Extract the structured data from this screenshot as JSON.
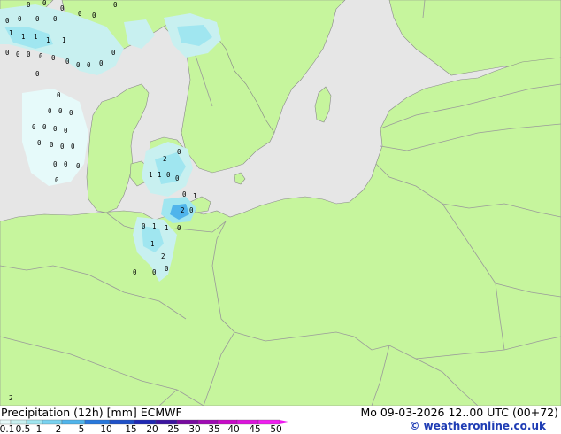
{
  "legend": {
    "title": "Precipitation (12h) [mm] ECMWF",
    "datetime": "Mo 09-03-2026 12..00 UTC (00+72)",
    "credit": "© weatheronline.co.uk",
    "classes": [
      {
        "label": "0.1",
        "color": "#e6fafa"
      },
      {
        "label": "0.5",
        "color": "#c8f0f0"
      },
      {
        "label": "1",
        "color": "#a0e6f0"
      },
      {
        "label": "2",
        "color": "#78d2f0"
      },
      {
        "label": "5",
        "color": "#50b4eb"
      },
      {
        "label": "10",
        "color": "#2878dc"
      },
      {
        "label": "15",
        "color": "#1e50c8"
      },
      {
        "label": "20",
        "color": "#1e28b4"
      },
      {
        "label": "25",
        "color": "#3c14a0"
      },
      {
        "label": "30",
        "color": "#780aa0"
      },
      {
        "label": "35",
        "color": "#a00ab4"
      },
      {
        "label": "40",
        "color": "#c80ac8"
      },
      {
        "label": "45",
        "color": "#dc14dc"
      },
      {
        "label": "50",
        "color": "#f01ef0"
      }
    ]
  },
  "map": {
    "colors": {
      "land": "#c6f59d",
      "sea": "#e6e6e6",
      "borders": "#9a9a9a",
      "coast": "#8a8a8a"
    },
    "labels": {
      "skagerrak": [
        "0",
        "0",
        "0",
        "0",
        "0",
        "0",
        "0",
        "0",
        "0",
        "0",
        "1",
        "1",
        "1",
        "1",
        "1",
        "0",
        "0",
        "0",
        "0",
        "0",
        "0",
        "0",
        "0",
        "0",
        "0"
      ],
      "northsea": [
        "0",
        "0",
        "0",
        "0",
        "0",
        "0",
        "0",
        "0",
        "0",
        "0",
        "0",
        "0",
        "0",
        "0",
        "0",
        "0",
        "0"
      ],
      "islands": [
        "2",
        "0",
        "1",
        "1",
        "0",
        "0",
        "0",
        "1",
        "2",
        "0"
      ],
      "germany": [
        "1",
        "1",
        "0",
        "0",
        "1",
        "2",
        "0",
        "0",
        "0",
        "2"
      ]
    }
  }
}
